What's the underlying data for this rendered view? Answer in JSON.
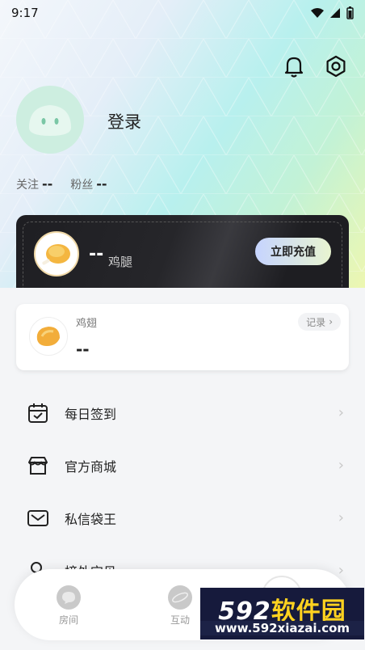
{
  "status_bar": {
    "time": "9:17"
  },
  "profile": {
    "login_text": "登录",
    "following_label": "关注",
    "following_value": "--",
    "fans_label": "粉丝",
    "fans_value": "--"
  },
  "vip_card": {
    "count": "--",
    "currency_label": "鸡腿",
    "recharge_label": "立即充值"
  },
  "wings_card": {
    "label": "鸡翅",
    "count": "--",
    "record_label": "记录",
    "record_arrow": "›"
  },
  "menu": {
    "items": [
      {
        "label": "每日签到",
        "icon": "calendar-check-icon"
      },
      {
        "label": "官方商城",
        "icon": "store-icon"
      },
      {
        "label": "私信袋王",
        "icon": "mail-icon"
      },
      {
        "label": "榜外宝贝",
        "icon": "search-user-icon"
      }
    ],
    "arrow": "›"
  },
  "bottom_nav": {
    "items": [
      {
        "label": "房间"
      },
      {
        "label": "互动"
      }
    ]
  },
  "watermark": {
    "brand_number": "592",
    "brand_text": "软件园",
    "url": "www.592xiazai.com"
  },
  "colors": {
    "accent_dark": "#1e1e22",
    "background": "#f4f5f7",
    "watermark_yellow": "#ffd21f"
  }
}
